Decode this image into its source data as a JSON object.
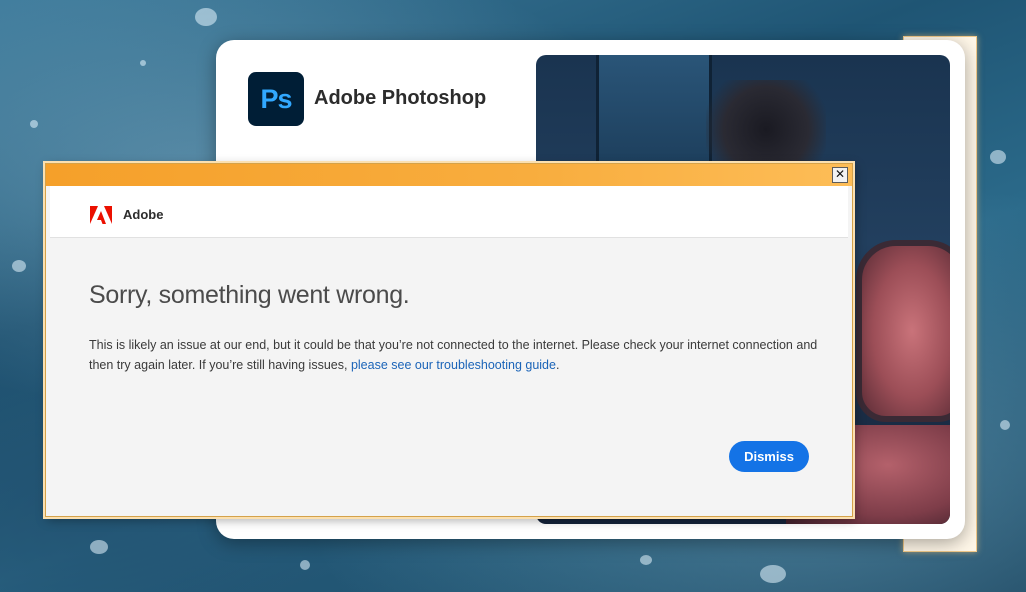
{
  "splash": {
    "logo_text": "Ps",
    "title": "Adobe Photoshop"
  },
  "dialog": {
    "close_glyph": "✕",
    "header_label": "Adobe",
    "title": "Sorry, something went wrong.",
    "body_text": "This is likely an issue at our end, but it could be that you’re not connected to the internet. Please check your internet connection and then try again later. If you’re still having issues, ",
    "link_text": "please see our troubleshooting guide",
    "body_end": ".",
    "dismiss_label": "Dismiss"
  },
  "colors": {
    "accent_blue": "#1473e6",
    "titlebar_orange": "#f5a02a",
    "ps_logo_bg": "#001e36",
    "ps_logo_text": "#31a8ff",
    "adobe_red": "#eb1000"
  }
}
